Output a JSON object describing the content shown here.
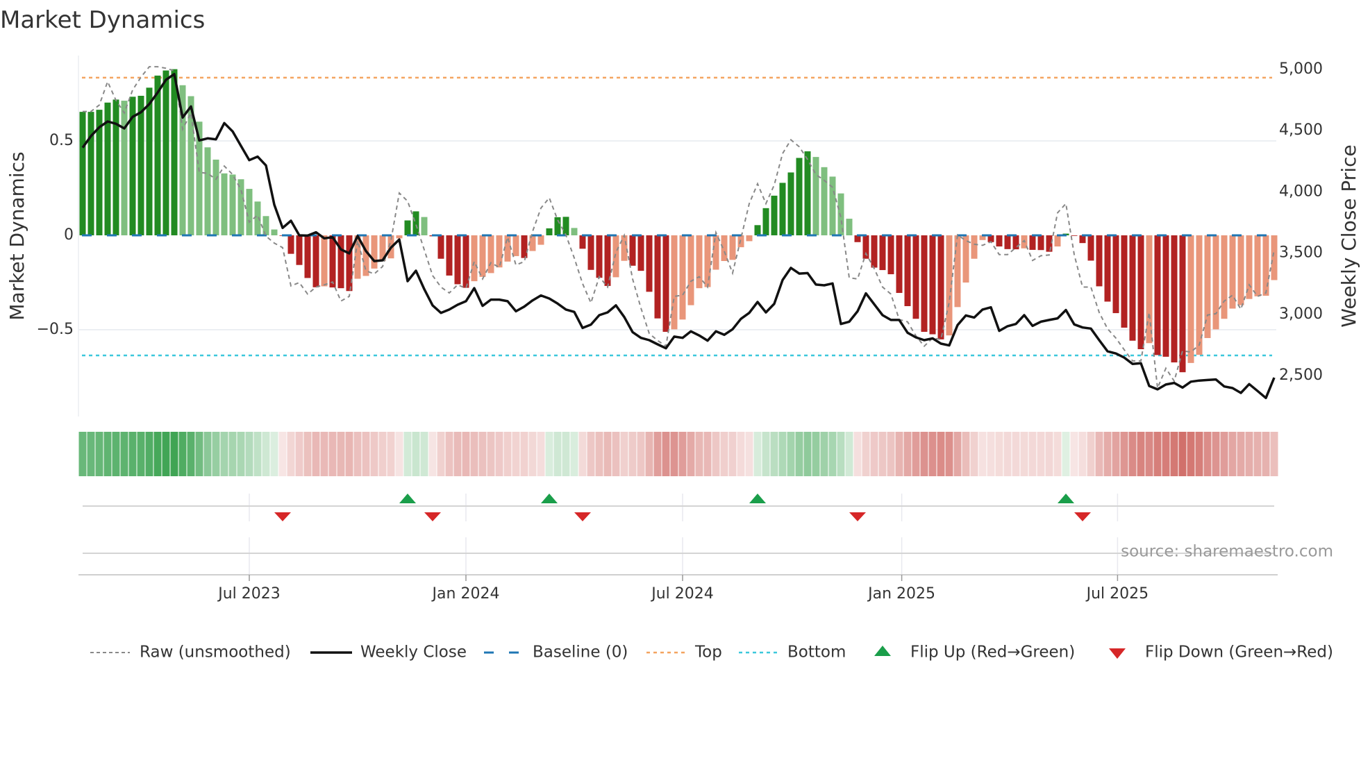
{
  "chart_data": {
    "type": "bar",
    "title": "Market Dynamics",
    "ylabel_left": "Market Dynamics",
    "ylabel_right": "Weekly Close Price",
    "left_ticks": [
      {
        "value": 0.5,
        "label": "0.5"
      },
      {
        "value": 0,
        "label": "0"
      },
      {
        "value": -0.5,
        "label": "−0.5"
      }
    ],
    "right_ticks": [
      {
        "value": 5000,
        "label": "5,000"
      },
      {
        "value": 4500,
        "label": "4,500"
      },
      {
        "value": 4000,
        "label": "4,000"
      },
      {
        "value": 3500,
        "label": "3,500"
      },
      {
        "value": 3000,
        "label": "3,000"
      },
      {
        "value": 2500,
        "label": "2,500"
      }
    ],
    "x_ticks": [
      {
        "week": 21,
        "label": "Jul 2023"
      },
      {
        "week": 47,
        "label": "Jan 2024"
      },
      {
        "week": 73,
        "label": "Jul 2024"
      },
      {
        "week": 99.3,
        "label": "Jan 2025"
      },
      {
        "week": 125.2,
        "label": "Jul 2025"
      }
    ],
    "top_level": 0.835,
    "bottom_level": -0.636,
    "baseline": 0,
    "smoothed": [
      0.654,
      0.654,
      0.665,
      0.703,
      0.719,
      0.713,
      0.734,
      0.739,
      0.782,
      0.846,
      0.873,
      0.88,
      0.795,
      0.737,
      0.602,
      0.466,
      0.401,
      0.328,
      0.322,
      0.297,
      0.246,
      0.179,
      0.102,
      0.031,
      -0.003,
      -0.098,
      -0.157,
      -0.226,
      -0.275,
      -0.27,
      -0.276,
      -0.28,
      -0.295,
      -0.23,
      -0.215,
      -0.176,
      -0.136,
      -0.122,
      -0.016,
      0.079,
      0.127,
      0.097,
      -0.005,
      -0.124,
      -0.213,
      -0.259,
      -0.278,
      -0.243,
      -0.22,
      -0.2,
      -0.17,
      -0.139,
      -0.11,
      -0.12,
      -0.083,
      -0.05,
      0.037,
      0.096,
      0.098,
      0.039,
      -0.071,
      -0.183,
      -0.225,
      -0.268,
      -0.222,
      -0.135,
      -0.161,
      -0.188,
      -0.299,
      -0.44,
      -0.511,
      -0.498,
      -0.446,
      -0.37,
      -0.28,
      -0.274,
      -0.182,
      -0.136,
      -0.13,
      -0.063,
      -0.031,
      0.054,
      0.144,
      0.21,
      0.278,
      0.333,
      0.41,
      0.445,
      0.415,
      0.361,
      0.311,
      0.222,
      0.088,
      -0.036,
      -0.124,
      -0.171,
      -0.184,
      -0.206,
      -0.305,
      -0.375,
      -0.442,
      -0.511,
      -0.524,
      -0.551,
      -0.53,
      -0.38,
      -0.25,
      -0.124,
      -0.025,
      -0.036,
      -0.059,
      -0.073,
      -0.074,
      -0.069,
      -0.077,
      -0.078,
      -0.087,
      -0.059,
      0.009,
      -0.003,
      -0.041,
      -0.134,
      -0.27,
      -0.351,
      -0.412,
      -0.489,
      -0.558,
      -0.603,
      -0.571,
      -0.634,
      -0.643,
      -0.673,
      -0.725,
      -0.676,
      -0.633,
      -0.544,
      -0.498,
      -0.442,
      -0.388,
      -0.37,
      -0.337,
      -0.323,
      -0.32,
      -0.237
    ],
    "raw": [
      0.656,
      0.656,
      0.69,
      0.814,
      0.715,
      0.648,
      0.77,
      0.838,
      0.893,
      0.893,
      0.885,
      0.871,
      0.562,
      0.648,
      0.334,
      0.328,
      0.297,
      0.367,
      0.322,
      0.242,
      0.07,
      0.107,
      -0.004,
      -0.041,
      -0.065,
      -0.268,
      -0.25,
      -0.311,
      -0.274,
      -0.262,
      -0.247,
      -0.348,
      -0.323,
      -0.028,
      -0.188,
      -0.204,
      -0.165,
      -0.028,
      0.224,
      0.181,
      0.058,
      -0.077,
      -0.213,
      -0.274,
      -0.305,
      -0.262,
      -0.28,
      -0.139,
      -0.231,
      -0.145,
      -0.17,
      -0.01,
      -0.157,
      -0.139,
      0.021,
      0.144,
      0.199,
      0.082,
      0.002,
      -0.12,
      -0.256,
      -0.358,
      -0.219,
      -0.274,
      -0.09,
      0,
      -0.231,
      -0.385,
      -0.52,
      -0.557,
      -0.587,
      -0.323,
      -0.317,
      -0.243,
      -0.219,
      -0.274,
      0.015,
      -0.084,
      -0.2,
      -0.016,
      0.168,
      0.273,
      0.168,
      0.267,
      0.433,
      0.506,
      0.469,
      0.402,
      0.322,
      0.291,
      0.254,
      0.095,
      -0.225,
      -0.231,
      -0.096,
      -0.176,
      -0.274,
      -0.311,
      -0.446,
      -0.458,
      -0.532,
      -0.587,
      -0.544,
      -0.551,
      -0.354,
      0.002,
      -0.028,
      -0.047,
      -0.053,
      -0.034,
      -0.102,
      -0.102,
      -0.065,
      -0.028,
      -0.133,
      -0.108,
      -0.104,
      0.119,
      0.168,
      -0.102,
      -0.274,
      -0.274,
      -0.409,
      -0.495,
      -0.544,
      -0.606,
      -0.665,
      -0.665,
      -0.409,
      -0.809,
      -0.704,
      -0.772,
      -0.612,
      -0.618,
      -0.581,
      -0.422,
      -0.415,
      -0.348,
      -0.317,
      -0.391,
      -0.262,
      -0.323,
      -0.305,
      -0.077
    ],
    "weekly_close": [
      4361,
      4456,
      4528,
      4575,
      4556,
      4518,
      4613,
      4650,
      4717,
      4811,
      4915,
      4962,
      4607,
      4698,
      4420,
      4437,
      4429,
      4562,
      4494,
      4376,
      4259,
      4288,
      4216,
      3895,
      3706,
      3764,
      3645,
      3643,
      3670,
      3621,
      3630,
      3530,
      3498,
      3640,
      3517,
      3435,
      3441,
      3545,
      3611,
      3271,
      3356,
      3205,
      3073,
      3012,
      3039,
      3078,
      3107,
      3214,
      3069,
      3120,
      3120,
      3107,
      3025,
      3063,
      3114,
      3154,
      3129,
      3088,
      3039,
      3020,
      2889,
      2916,
      2993,
      3016,
      3073,
      2978,
      2855,
      2808,
      2789,
      2755,
      2723,
      2818,
      2808,
      2861,
      2827,
      2785,
      2861,
      2833,
      2878,
      2963,
      3012,
      3101,
      3016,
      3086,
      3280,
      3379,
      3333,
      3337,
      3243,
      3237,
      3252,
      2921,
      2940,
      3025,
      3171,
      3082,
      2993,
      2954,
      2954,
      2850,
      2812,
      2789,
      2804,
      2761,
      2746,
      2912,
      2991,
      2974,
      3039,
      3057,
      2865,
      2903,
      2921,
      2993,
      2906,
      2940,
      2954,
      2967,
      3035,
      2918,
      2893,
      2884,
      2789,
      2698,
      2680,
      2647,
      2595,
      2601,
      2415,
      2387,
      2427,
      2440,
      2402,
      2450,
      2459,
      2464,
      2468,
      2411,
      2398,
      2358,
      2430,
      2374,
      2317,
      2483
    ],
    "flip_up_weeks": [
      40,
      57,
      82,
      119
    ],
    "flip_down_weeks": [
      25,
      43,
      61,
      94,
      121
    ],
    "legend": [
      {
        "key": "raw",
        "label": "Raw (unsmoothed)"
      },
      {
        "key": "close",
        "label": "Weekly Close"
      },
      {
        "key": "baseline",
        "label": "Baseline (0)"
      },
      {
        "key": "top",
        "label": "Top"
      },
      {
        "key": "bottom",
        "label": "Bottom"
      },
      {
        "key": "up",
        "label": "Flip Up (Red→Green)"
      },
      {
        "key": "down",
        "label": "Flip Down (Green→Red)"
      }
    ],
    "legend_position": "bottom",
    "source": "source: sharemaestro.com",
    "colors": {
      "green_strong": "#228b22",
      "green_weak": "#7fbf7f",
      "red_strong": "#b22222",
      "red_weak": "#e9967a",
      "raw": "#888888",
      "close": "#111111",
      "baseline": "#1f77b4",
      "top": "#f4a460",
      "bottom": "#3cc8dc",
      "flip_up": "#1a9e4a",
      "flip_down": "#d62728"
    }
  }
}
